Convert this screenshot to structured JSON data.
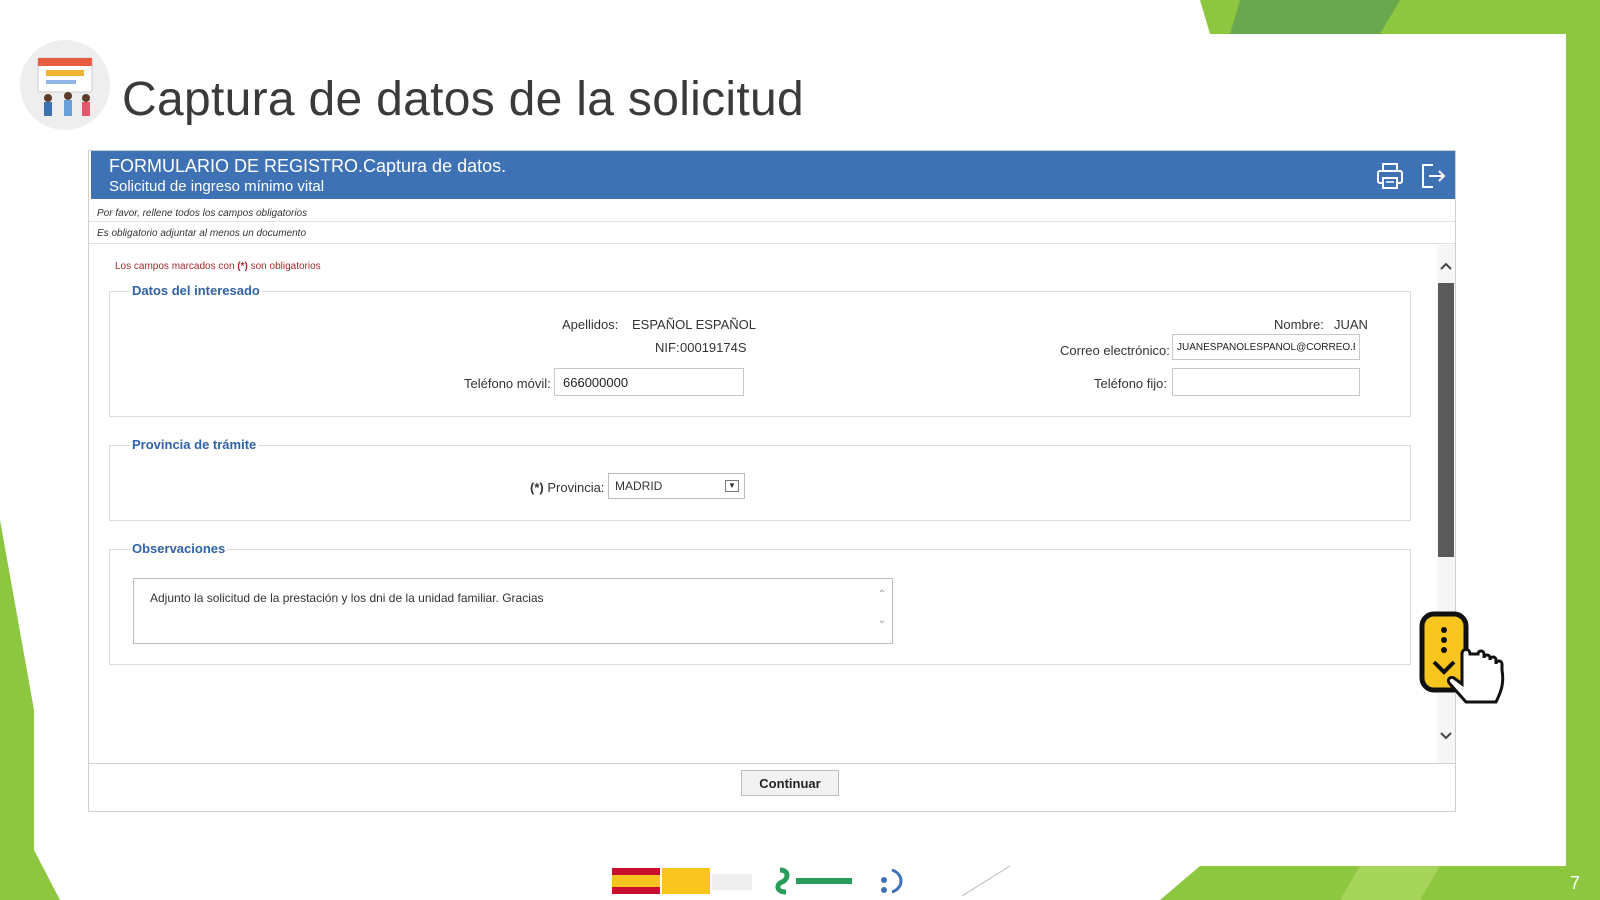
{
  "slide": {
    "title": "Captura de datos de la solicitud",
    "page_number": "7",
    "accent_color": "#8dc63f"
  },
  "form": {
    "header_title": "FORMULARIO DE REGISTRO.Captura de datos.",
    "header_subtitle": "Solicitud de ingreso mínimo vital",
    "header_color": "#3f72b5",
    "print_icon": "printer-icon",
    "exit_icon": "exit-icon",
    "note_required": "Por favor, rellene todos los campos obligatorios",
    "note_document": "Es obligatorio adjuntar al menos un documento",
    "required_legend_prefix": "Los campos marcados con ",
    "required_legend_mark": "(*)",
    "required_legend_suffix": " son obligatorios"
  },
  "interesado": {
    "legend": "Datos del interesado",
    "apellidos_label": "Apellidos:",
    "apellidos_value": "ESPAÑOL ESPAÑOL",
    "nombre_label": "Nombre:",
    "nombre_value": "JUAN",
    "nif_label": "NIF:",
    "nif_value": "00019174S",
    "correo_label": "Correo electrónico:",
    "correo_value": "JUANESPAÑOLESPAÑOL@CORREO.ES",
    "movil_label": "Teléfono móvil:",
    "movil_value": "666000000",
    "fijo_label": "Teléfono fijo:",
    "fijo_value": ""
  },
  "provincia": {
    "legend": "Provincia de trámite",
    "required_mark": "(*)",
    "label": "Provincia:",
    "selected": "MADRID"
  },
  "observaciones": {
    "legend": "Observaciones",
    "text": "Adjunto la solicitud de la prestación y los dni de la unidad familiar. Gracias"
  },
  "footer": {
    "continue_label": "Continuar"
  }
}
